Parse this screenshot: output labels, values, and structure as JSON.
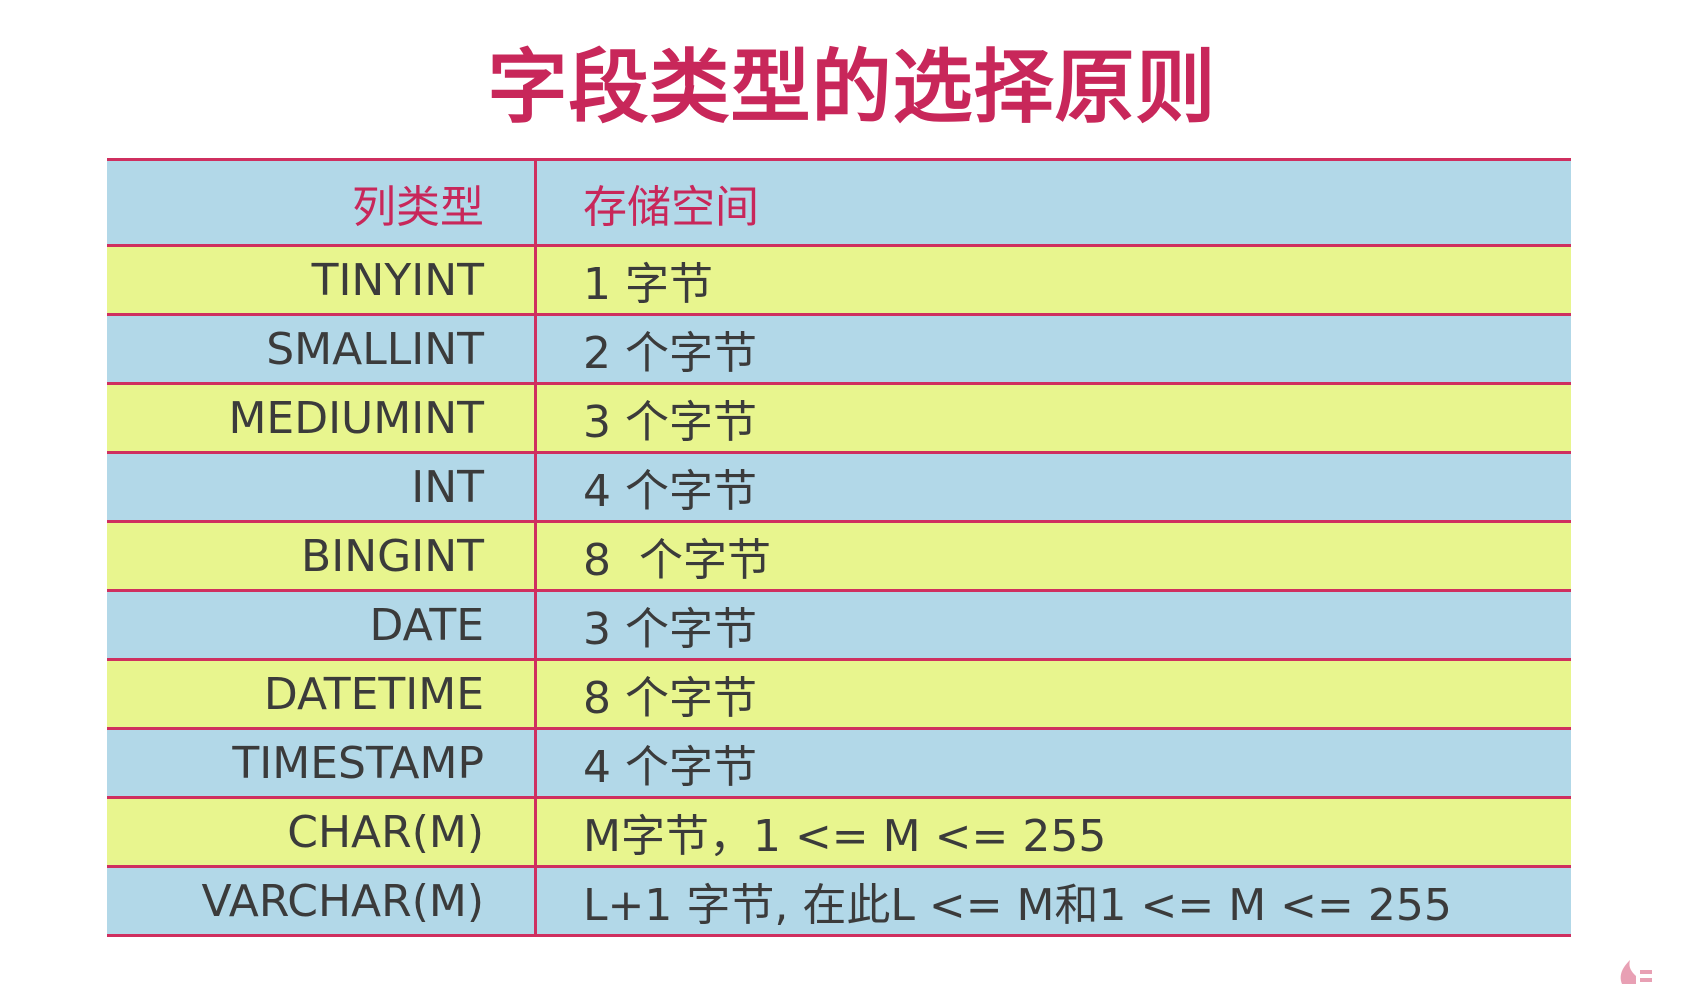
{
  "title": "字段类型的选择原则",
  "table": {
    "headers": {
      "type": "列类型",
      "storage": "存储空间"
    },
    "rows": [
      {
        "type": "TINYINT",
        "storage": "1 字节"
      },
      {
        "type": "SMALLINT",
        "storage": "2 个字节"
      },
      {
        "type": "MEDIUMINT",
        "storage": "3 个字节"
      },
      {
        "type": "INT",
        "storage": "4 个字节"
      },
      {
        "type": "BINGINT",
        "storage": "8  个字节"
      },
      {
        "type": "DATE",
        "storage": "3 个字节"
      },
      {
        "type": "DATETIME",
        "storage": "8 个字节"
      },
      {
        "type": "TIMESTAMP",
        "storage": "4 个字节"
      },
      {
        "type": "CHAR(M)",
        "storage": "M字节，1 <= M <= 255"
      },
      {
        "type": "VARCHAR(M)",
        "storage": "L+1 字节, 在此L <= M和1 <= M <= 255"
      }
    ]
  },
  "colors": {
    "accent": "#c8275a",
    "row_blue": "#b2d8e8",
    "row_yellow": "#e8f58e",
    "border": "#cf2f5f",
    "text": "#3b3b3b"
  }
}
